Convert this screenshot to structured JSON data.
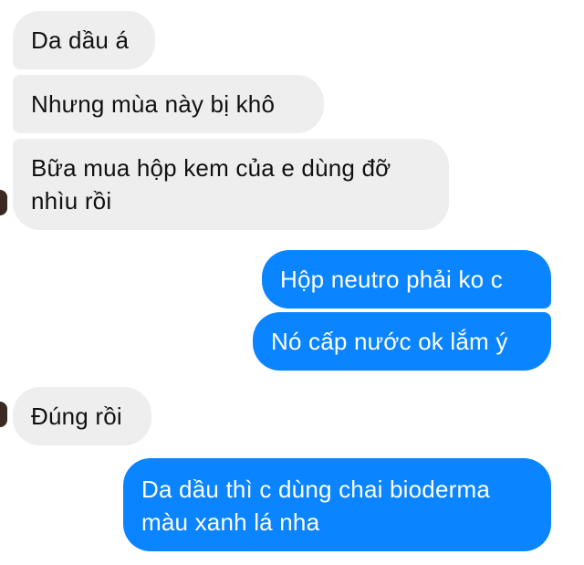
{
  "conversation": {
    "messages": [
      {
        "sender": "other",
        "text": "Da dầu á"
      },
      {
        "sender": "other",
        "text": "Nhưng mùa này bị khô"
      },
      {
        "sender": "other",
        "text": "Bữa mua hộp kem của e dùng đỡ nhìu rồi"
      },
      {
        "sender": "me",
        "text": "Hộp neutro phải ko c"
      },
      {
        "sender": "me",
        "text": "Nó cấp nước ok lắm ý"
      },
      {
        "sender": "other",
        "text": "Đúng rồi"
      },
      {
        "sender": "me",
        "text": "Da dầu thì c dùng chai bioderma màu xanh lá nha"
      }
    ]
  },
  "colors": {
    "incoming_bubble": "#eeeeef",
    "outgoing_bubble": "#0a84ff",
    "incoming_text": "#111111",
    "outgoing_text": "#ffffff"
  }
}
